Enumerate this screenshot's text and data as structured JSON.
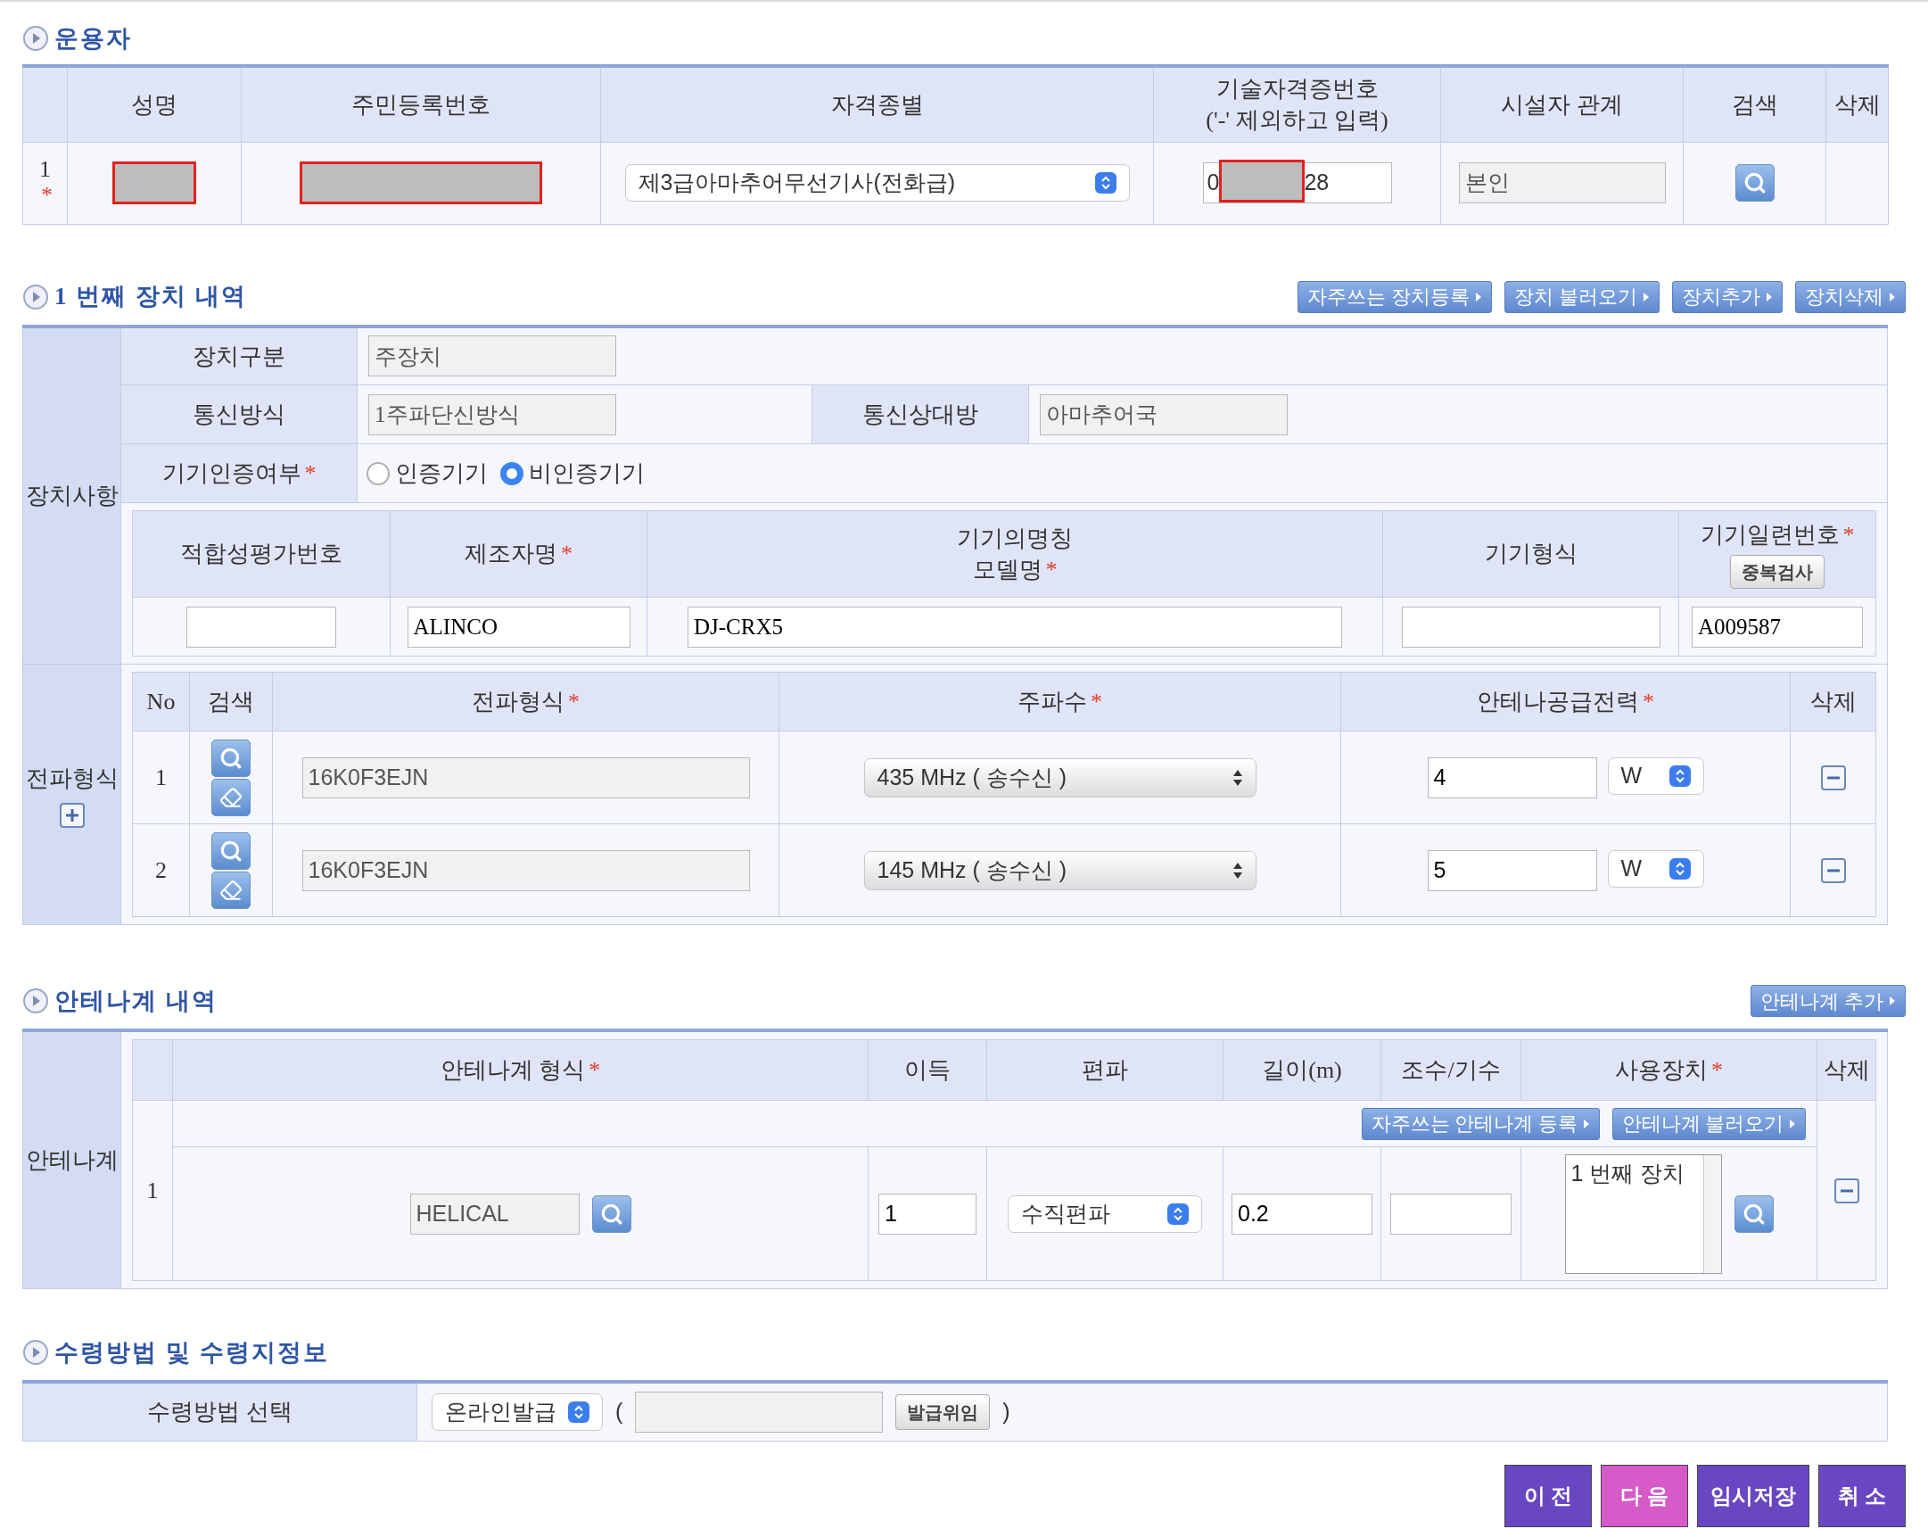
{
  "operator": {
    "title": "운용자",
    "columns": [
      {
        "label": "성명"
      },
      {
        "label": "주민등록번호"
      },
      {
        "label": "자격종별"
      },
      {
        "label": "기술자격증번호",
        "sub": "('-' 제외하고 입력)"
      },
      {
        "label": "시설자 관계"
      },
      {
        "label": "검색"
      },
      {
        "label": "삭제"
      }
    ],
    "rows": [
      {
        "no": "1",
        "mark": "*",
        "qualification": "제3급아마추어무선기사(전화급)",
        "license_start": "0",
        "license_end": "28",
        "relation": "본인"
      }
    ]
  },
  "device": {
    "title": "1 번째 장치 내역",
    "buttons": [
      "자주쓰는 장치등록",
      "장치 불러오기",
      "장치추가",
      "장치삭제"
    ],
    "group_label": "장치사항",
    "fields": [
      {
        "label": "장치구분",
        "value": "주장치"
      },
      {
        "label": "통신방식",
        "value": "1주파단신방식"
      },
      {
        "label": "통신상대방",
        "value": "아마추어국"
      }
    ],
    "certification": {
      "label": "기기인증여부",
      "mark": "*",
      "options": [
        {
          "label": "인증기기",
          "selected": false
        },
        {
          "label": "비인증기기",
          "selected": true
        }
      ]
    },
    "equipment": {
      "columns": [
        {
          "label": "적합성평가번호"
        },
        {
          "label": "제조자명",
          "mark": "*"
        },
        {
          "label": "기기의명칭",
          "sub": "모델명",
          "mark": "*"
        },
        {
          "label": "기기형식"
        },
        {
          "label": "기기일련번호",
          "mark": "*"
        }
      ],
      "check_button": "중복검사",
      "maker": "ALINCO",
      "model": "DJ-CRX5",
      "serial": "A009587"
    }
  },
  "emission": {
    "group_label": "전파형식",
    "columns": [
      {
        "label": "No"
      },
      {
        "label": "검색"
      },
      {
        "label": "전파형식",
        "mark": "*"
      },
      {
        "label": "주파수",
        "mark": "*"
      },
      {
        "label": "안테나공급전력",
        "mark": "*"
      },
      {
        "label": "삭제"
      }
    ],
    "rows": [
      {
        "no": "1",
        "type": "16K0F3EJN",
        "frequency": "435 MHz ( 송수신 )",
        "power": "4",
        "unit": "W"
      },
      {
        "no": "2",
        "type": "16K0F3EJN",
        "frequency": "145 MHz ( 송수신 )",
        "power": "5",
        "unit": "W"
      }
    ]
  },
  "antenna": {
    "title": "안테나계 내역",
    "add_button": "안테나계 추가",
    "group_label": "안테나계",
    "columns": [
      {
        "label": "안테나계 형식",
        "mark": "*"
      },
      {
        "label": "이득"
      },
      {
        "label": "편파"
      },
      {
        "label": "길이(m)"
      },
      {
        "label": "조수/기수"
      },
      {
        "label": "사용장치",
        "mark": "*"
      },
      {
        "label": "삭제"
      }
    ],
    "buttons": [
      "자주쓰는 안테나계 등록",
      "안테나계 불러오기"
    ],
    "rows": [
      {
        "no": "1",
        "type": "HELICAL",
        "gain": "1",
        "polarization": "수직편파",
        "length": "0.2",
        "devices": [
          "1 번째 장치"
        ]
      }
    ]
  },
  "receipt": {
    "title": "수령방법 및 수령지정보",
    "label": "수령방법 선택",
    "method": "온라인발급",
    "open": "(",
    "delegate_button": "발급위임",
    "close": ")"
  },
  "actions": [
    {
      "label": "이 전",
      "kind": "prev"
    },
    {
      "label": "다 음",
      "kind": "next"
    },
    {
      "label": "임시저장",
      "kind": "save"
    },
    {
      "label": "취 소",
      "kind": "cancel"
    }
  ]
}
